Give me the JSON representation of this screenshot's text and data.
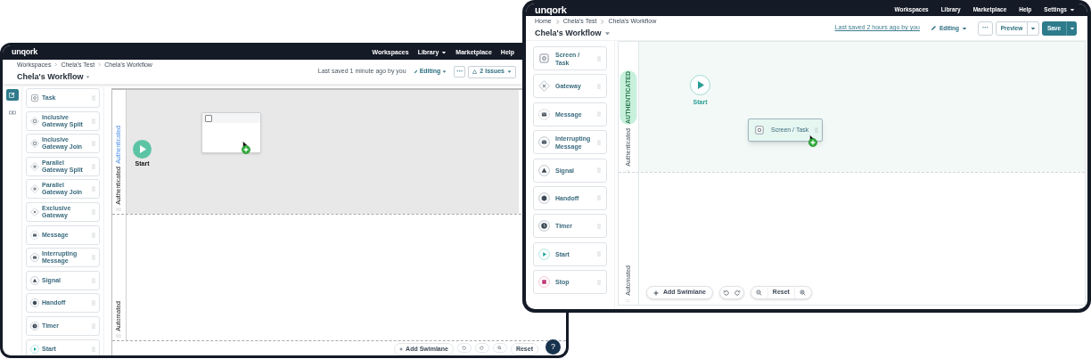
{
  "back_window": {
    "kind": "legacy",
    "nav": {
      "logo": "unqork",
      "links": [
        {
          "label": "Workspaces",
          "dropdown": false
        },
        {
          "label": "Library",
          "dropdown": true
        },
        {
          "label": "Marketplace",
          "dropdown": false
        },
        {
          "label": "Help",
          "dropdown": false
        }
      ]
    },
    "breadcrumbs": [
      "Workspaces",
      "Chela's Test",
      "Chela's Workflow"
    ],
    "title": "Chela's Workflow",
    "saved": "Last saved 1 minute ago by you",
    "mode": "Editing",
    "more": "···",
    "issues": "2 Issues",
    "rail": [
      {
        "kind": "edit",
        "selected": true
      },
      {
        "kind": "components",
        "selected": false
      }
    ],
    "palette": [
      {
        "kind": "task",
        "label": "Task"
      },
      {
        "kind": "inclusive_split",
        "label": "Inclusive Gateway Split"
      },
      {
        "kind": "inclusive_join",
        "label": "Inclusive Gateway Join"
      },
      {
        "kind": "parallel_split",
        "label": "Parallel Gateway Split"
      },
      {
        "kind": "parallel_join",
        "label": "Parallel Gateway Join"
      },
      {
        "kind": "exclusive",
        "label": "Exclusive Gateway"
      },
      {
        "kind": "message",
        "label": "Message"
      },
      {
        "kind": "interrupting",
        "label": "Interrupting Message"
      },
      {
        "kind": "signal",
        "label": "Signal"
      },
      {
        "kind": "handoff",
        "label": "Handoff"
      },
      {
        "kind": "timer",
        "label": "Timer"
      },
      {
        "kind": "start",
        "label": "Start"
      }
    ],
    "lanes": [
      {
        "label": "Authenticated",
        "sublabel": "Authenticated"
      },
      {
        "label": "Automated"
      }
    ],
    "nodes": [
      {
        "kind": "start",
        "label": "Start"
      },
      {
        "kind": "task"
      }
    ],
    "toolbar": {
      "add": "Add Swimlane",
      "reset": "Reset",
      "help": "?"
    }
  },
  "front_window": {
    "kind": "redesign",
    "nav": {
      "logo": "unqork",
      "links": [
        {
          "label": "Workspaces",
          "dropdown": false
        },
        {
          "label": "Library",
          "dropdown": false
        },
        {
          "label": "Marketplace",
          "dropdown": false
        },
        {
          "label": "Help",
          "dropdown": false
        },
        {
          "label": "Settings",
          "dropdown": true
        }
      ]
    },
    "breadcrumbs": [
      "Home",
      "Chela's Test",
      "Chela's Workflow"
    ],
    "title": "Chela's Workflow",
    "saved": "Last saved 2 hours ago by you",
    "mode": "Editing",
    "more": "···",
    "preview": "Preview",
    "save": "Save",
    "palette": [
      {
        "kind": "task",
        "label": "Screen / Task"
      },
      {
        "kind": "exclusive",
        "label": "Gateway"
      },
      {
        "kind": "message",
        "label": "Message"
      },
      {
        "kind": "interrupting",
        "label": "Interrupting Message"
      },
      {
        "kind": "signal",
        "label": "Signal"
      },
      {
        "kind": "handoff",
        "label": "Handoff"
      },
      {
        "kind": "timer",
        "label": "Timer"
      },
      {
        "kind": "start",
        "label": "Start"
      },
      {
        "kind": "stop",
        "label": "Stop"
      }
    ],
    "lanes": [
      {
        "label": "Authenticated",
        "badge": "AUTHENTICATED"
      },
      {
        "label": "Automated"
      }
    ],
    "nodes": [
      {
        "kind": "start",
        "label": "Start"
      },
      {
        "kind": "task",
        "label": "Screen / Task"
      }
    ],
    "toolbar": {
      "add": "Add Swimlane",
      "reset": "Reset"
    }
  }
}
